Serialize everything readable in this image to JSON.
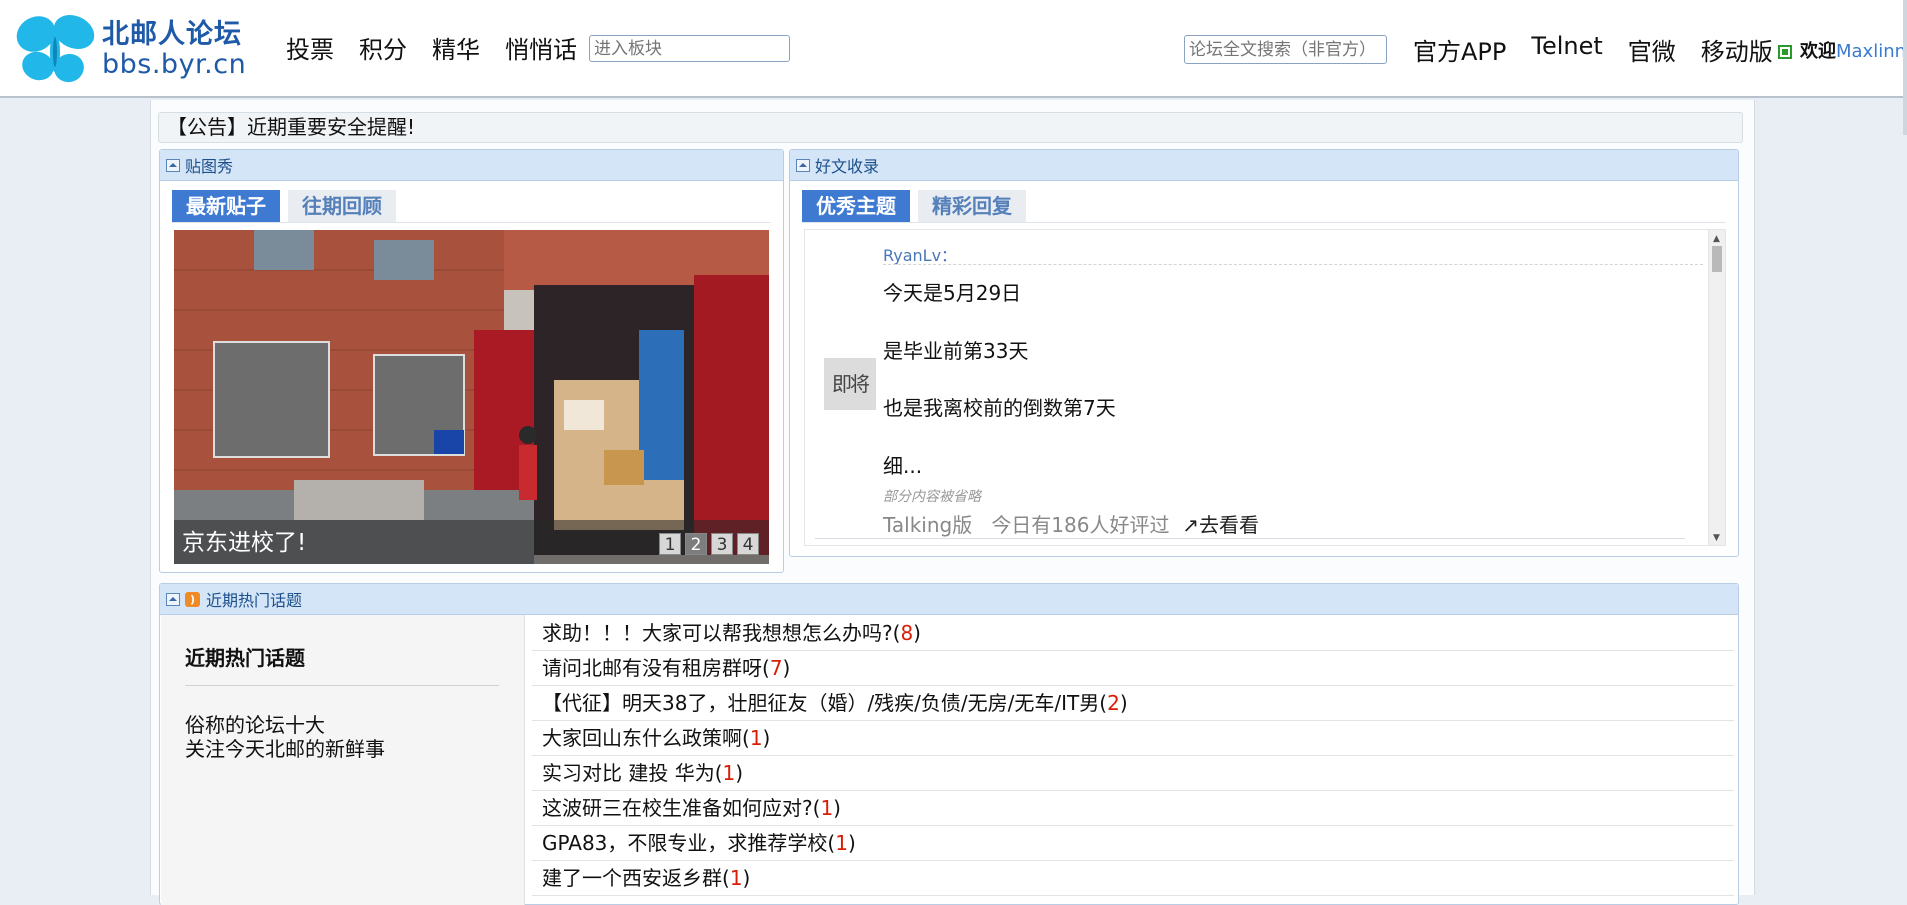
{
  "header": {
    "logo_cn": "北邮人论坛",
    "logo_en": "bbs.byr.cn",
    "nav_left": [
      "投票",
      "积分",
      "精华",
      "悄悄话"
    ],
    "board_placeholder": "进入板块",
    "search_placeholder": "论坛全文搜索（非官方）",
    "nav_right": [
      "官方APP",
      "Telnet",
      "官微",
      "移动版"
    ],
    "welcome": "欢迎",
    "username": "Maxlinn"
  },
  "announcement": "【公告】近期重要安全提醒!",
  "pic_show": {
    "title": "贴图秀",
    "tabs": [
      "最新贴子",
      "往期回顾"
    ],
    "caption": "京东进校了!",
    "pages": [
      "1",
      "2",
      "3",
      "4"
    ],
    "current_page": "2"
  },
  "good_posts": {
    "title": "好文收录",
    "tabs": [
      "优秀主题",
      "精彩回复"
    ],
    "author": "RyanLv",
    "author_suffix": "：",
    "avatar_text": "即将美好",
    "lines": [
      "今天是5月29日",
      "是毕业前第33天",
      "也是我离校前的倒数第7天",
      "细..."
    ],
    "omitted_note": "部分内容被省略",
    "board": "Talking版",
    "today_count": "今日有186人好评过",
    "goto": "↗去看看"
  },
  "hot_topics": {
    "panel_title": "近期热门话题",
    "title": "近期热门话题",
    "desc_line1": "俗称的论坛十大",
    "desc_line2": "关注今天北邮的新鲜事",
    "items": [
      {
        "title": "求助！！！大家可以帮我想想怎么办吗?",
        "count": "8"
      },
      {
        "title": "请问北邮有没有租房群呀",
        "count": "7"
      },
      {
        "title": "【代征】明天38了，壮胆征友（婚）/残疾/负债/无房/无车/IT男",
        "count": "2"
      },
      {
        "title": "大家回山东什么政策啊",
        "count": "1"
      },
      {
        "title": "实习对比 建投 华为",
        "count": "1"
      },
      {
        "title": "这波研三在校生准备如何应对?",
        "count": "1"
      },
      {
        "title": "GPA83，不限专业，求推荐学校",
        "count": "1"
      },
      {
        "title": "建了一个西安返乡群",
        "count": "1"
      }
    ]
  },
  "colors": {
    "accent": "#3f7ad2",
    "link": "#4a76b8",
    "count_red": "#d81e06",
    "panel_head": "#d4e5f7"
  }
}
